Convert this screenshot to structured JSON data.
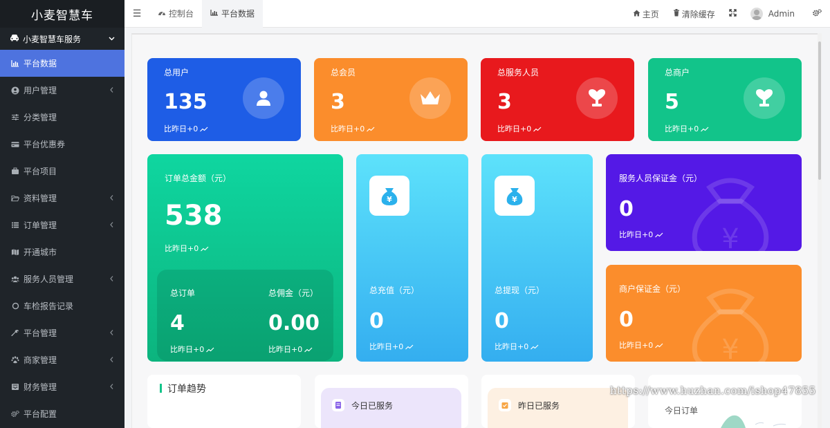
{
  "app": {
    "title": "小麦智慧车"
  },
  "sidebar": {
    "group_label": "小麦智慧车服务",
    "items": [
      {
        "label": "平台数据",
        "icon": "bar-chart-icon",
        "active": true,
        "has_children": false
      },
      {
        "label": "用户管理",
        "icon": "user-circle-icon",
        "active": false,
        "has_children": true
      },
      {
        "label": "分类管理",
        "icon": "sliders-icon",
        "active": false,
        "has_children": false
      },
      {
        "label": "平台优惠券",
        "icon": "credit-card-icon",
        "active": false,
        "has_children": false
      },
      {
        "label": "平台项目",
        "icon": "briefcase-icon",
        "active": false,
        "has_children": false
      },
      {
        "label": "资料管理",
        "icon": "folder-open-icon",
        "active": false,
        "has_children": true
      },
      {
        "label": "订单管理",
        "icon": "list-icon",
        "active": false,
        "has_children": true
      },
      {
        "label": "开通城市",
        "icon": "map-icon",
        "active": false,
        "has_children": false
      },
      {
        "label": "服务人员管理",
        "icon": "users-icon",
        "active": false,
        "has_children": true
      },
      {
        "label": "车检报告记录",
        "icon": "circle-icon",
        "active": false,
        "has_children": false
      },
      {
        "label": "平台管理",
        "icon": "wrench-icon",
        "active": false,
        "has_children": true
      },
      {
        "label": "商家管理",
        "icon": "paw-icon",
        "active": false,
        "has_children": true
      },
      {
        "label": "财务管理",
        "icon": "inbox-icon",
        "active": false,
        "has_children": true
      },
      {
        "label": "平台配置",
        "icon": "cogs-icon",
        "active": false,
        "has_children": false
      }
    ]
  },
  "topbar": {
    "tabs": [
      {
        "label": "控制台",
        "icon": "dashboard-icon",
        "active": false
      },
      {
        "label": "平台数据",
        "icon": "bar-chart-icon",
        "active": true
      }
    ],
    "home_label": "主页",
    "clear_cache_label": "清除缓存",
    "user_name": "Admin"
  },
  "stats": [
    {
      "label": "总用户",
      "value": "135",
      "delta": "比昨日+0",
      "color": "#1e5de6",
      "icon": "user-icon"
    },
    {
      "label": "总会员",
      "value": "3",
      "delta": "比昨日+0",
      "color": "#fb8d2c",
      "icon": "crown-icon"
    },
    {
      "label": "总服务人员",
      "value": "3",
      "delta": "比昨日+0",
      "color": "#e8191d",
      "icon": "heart-trophy-icon"
    },
    {
      "label": "总商户",
      "value": "5",
      "delta": "比昨日+0",
      "color": "#12c48a",
      "icon": "heart-trophy-icon"
    }
  ],
  "orders_total": {
    "label": "订单总金额（元）",
    "value": "538",
    "delta": "比昨日+0",
    "sub": [
      {
        "label": "总订单",
        "value": "4",
        "delta": "比昨日+0"
      },
      {
        "label": "总佣金（元）",
        "value": "0.00",
        "delta": "比昨日+0"
      }
    ]
  },
  "recharge": {
    "label": "总充值（元）",
    "value": "0",
    "delta": "比昨日+0",
    "icon": "money-bag-icon"
  },
  "withdraw": {
    "label": "总提现（元）",
    "value": "0",
    "delta": "比昨日+0",
    "icon": "money-bag-icon"
  },
  "staff_deposit": {
    "label": "服务人员保证金（元）",
    "value": "0",
    "delta": "比昨日+0",
    "color": "#5419e6"
  },
  "merchant_deposit": {
    "label": "商户保证金（元）",
    "value": "0",
    "delta": "比昨日+0",
    "color": "#fb8d2c"
  },
  "bottom": {
    "trend_title": "订单趋势",
    "today_served": "今日已服务",
    "yesterday_served": "昨日已服务",
    "today_orders": "今日订单"
  },
  "watermark": "https://www.huzhan.com/ishop47855"
}
